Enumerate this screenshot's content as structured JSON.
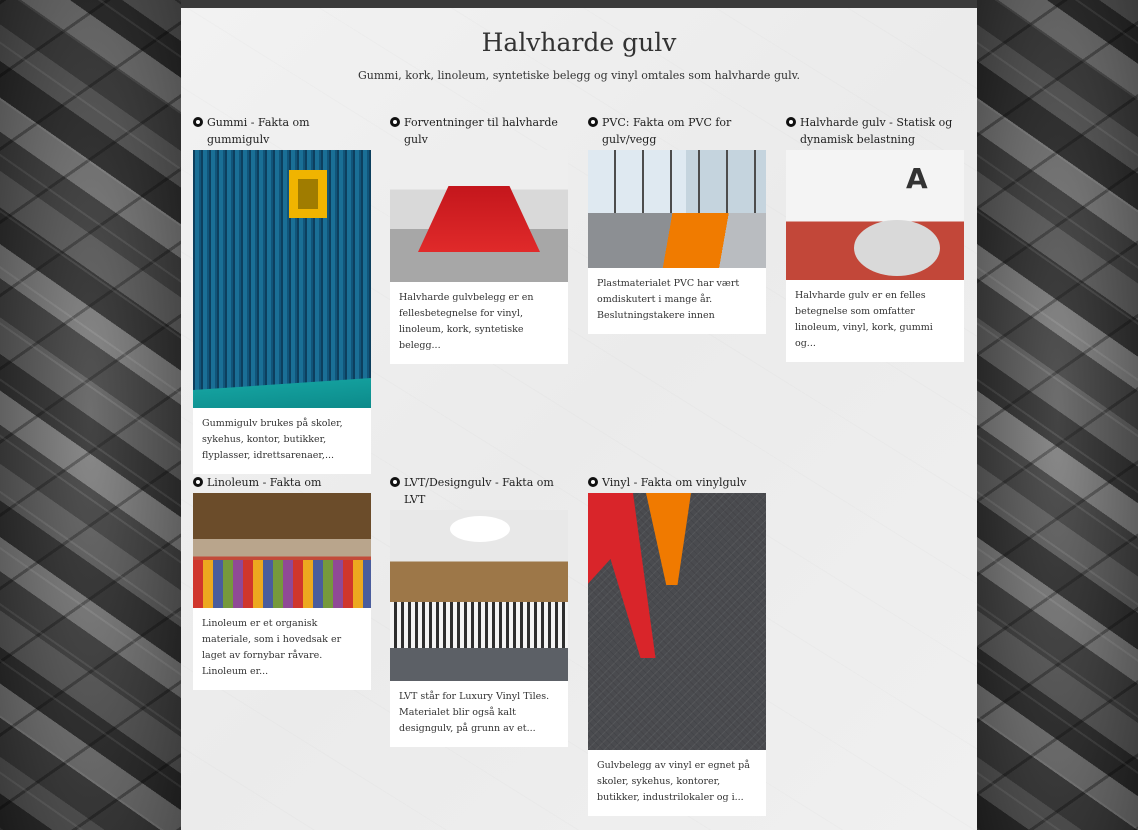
{
  "page": {
    "title": "Halvharde gulv",
    "subtitle": "Gummi, kork, linoleum, syntetiske belegg og vinyl omtales som halvharde gulv."
  },
  "cards": [
    {
      "title": "Gummi - Fakta om gummigulv",
      "description": "Gummigulv brukes på skoler, sykehus, kontor, butikker, flyplasser, idrettsarenaer,..."
    },
    {
      "title": "Forventninger til halvharde gulv",
      "description": "Halvharde gulvbelegg er en fellesbetegnelse for vinyl, linoleum, kork, syntetiske belegg..."
    },
    {
      "title": "PVC: Fakta om PVC for gulv/vegg",
      "description": "Plastmaterialet PVC har vært omdiskutert i mange år. Beslutningstakere innen"
    },
    {
      "title": "Halvharde gulv - Statisk og dynamisk belastning",
      "description": "Halvharde gulv er en felles betegnelse som omfatter linoleum, vinyl, kork, gummi og...",
      "image_letter": "A"
    },
    {
      "title": "Linoleum - Fakta om",
      "description": "Linoleum er et organisk materiale, som i hovedsak er laget av fornybar råvare. Linoleum er..."
    },
    {
      "title": "LVT/Designgulv - Fakta om LVT",
      "description": "LVT står for Luxury Vinyl Tiles. Materialet blir også kalt designgulv, på grunn av et..."
    },
    {
      "title": "Vinyl - Fakta om vinylgulv",
      "description": "Gulvbelegg av vinyl er egnet på skoler, sykehus, kontorer, butikker, industrilokaler og i..."
    }
  ]
}
